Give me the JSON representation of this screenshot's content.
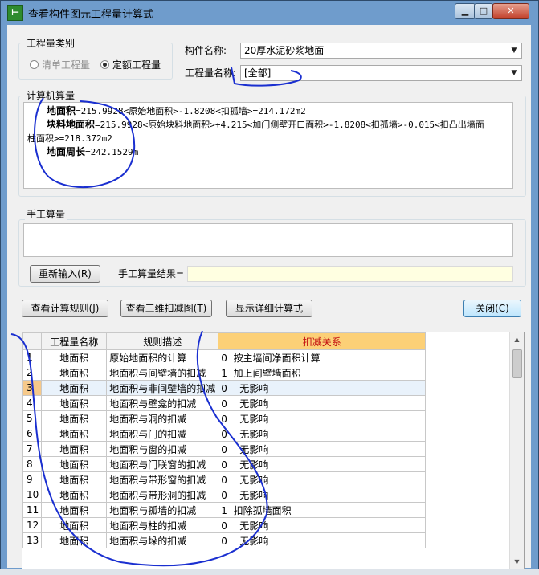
{
  "window": {
    "title": "查看构件图元工程量计算式",
    "icon_glyph": "⊢",
    "min_glyph": "▁",
    "max_glyph": "□",
    "close_glyph": "✕"
  },
  "category": {
    "legend": "工程量类别",
    "option_bill": "清单工程量",
    "option_quota": "定额工程量",
    "selected": "定额工程量"
  },
  "component": {
    "name_label": "构件名称:",
    "name_value": "20厚水泥砂浆地面",
    "qty_label": "工程量名称:",
    "qty_value": "[全部]"
  },
  "computer_calc": {
    "legend": "计算机算量",
    "lines": [
      {
        "key": "地面积",
        "expr": "=215.9928<原始地面积>-1.8208<扣孤墙>=214.172m2"
      },
      {
        "key": "块料地面积",
        "expr": "=215.9928<原始块料地面积>+4.215<加门侧壁开口面积>-1.8208<扣孤墙>-0.015<扣凸出墙面"
      },
      {
        "key": "",
        "expr": "柱面积>=218.372m2"
      },
      {
        "key": "地面周长",
        "expr": "=242.1529m"
      }
    ]
  },
  "manual_calc": {
    "legend": "手工算量",
    "reenter_button": "重新输入(R)",
    "result_label": "手工算量结果=",
    "result_value": ""
  },
  "actions": {
    "view_rules": "查看计算规则(J)",
    "view_3d": "查看三维扣减图(T)",
    "show_detail": "显示详细计算式",
    "close": "关闭(C)"
  },
  "grid": {
    "headers": [
      "",
      "工程量名称",
      "规则描述",
      "扣减关系"
    ],
    "rows": [
      {
        "no": "1",
        "qty": "地面积",
        "rule": "原始地面积的计算",
        "code": "0",
        "relation": "按主墙间净面积计算"
      },
      {
        "no": "2",
        "qty": "地面积",
        "rule": "地面积与间壁墙的扣减",
        "code": "1",
        "relation": "加上间壁墙面积"
      },
      {
        "no": "3",
        "qty": "地面积",
        "rule": "地面积与非间壁墙的扣减",
        "code": "0",
        "relation": "无影响"
      },
      {
        "no": "4",
        "qty": "地面积",
        "rule": "地面积与壁龛的扣减",
        "code": "0",
        "relation": "无影响"
      },
      {
        "no": "5",
        "qty": "地面积",
        "rule": "地面积与洞的扣减",
        "code": "0",
        "relation": "无影响"
      },
      {
        "no": "6",
        "qty": "地面积",
        "rule": "地面积与门的扣减",
        "code": "0",
        "relation": "无影响"
      },
      {
        "no": "7",
        "qty": "地面积",
        "rule": "地面积与窗的扣减",
        "code": "0",
        "relation": "无影响"
      },
      {
        "no": "8",
        "qty": "地面积",
        "rule": "地面积与门联窗的扣减",
        "code": "0",
        "relation": "无影响"
      },
      {
        "no": "9",
        "qty": "地面积",
        "rule": "地面积与带形窗的扣减",
        "code": "0",
        "relation": "无影响"
      },
      {
        "no": "10",
        "qty": "地面积",
        "rule": "地面积与带形洞的扣减",
        "code": "0",
        "relation": "无影响"
      },
      {
        "no": "11",
        "qty": "地面积",
        "rule": "地面积与孤墙的扣减",
        "code": "1",
        "relation": "扣除孤墙面积"
      },
      {
        "no": "12",
        "qty": "地面积",
        "rule": "地面积与柱的扣减",
        "code": "0",
        "relation": "无影响"
      },
      {
        "no": "13",
        "qty": "地面积",
        "rule": "地面积与垛的扣减",
        "code": "0",
        "relation": "无影响"
      }
    ],
    "selected_row": "3"
  },
  "colors": {
    "title_bar": "#6f9ccc",
    "dialog_bg": "#f0f0f0",
    "header_highlight": "#fcd077",
    "header_highlight_text": "#c41212",
    "ink": "#1a2fd0"
  }
}
